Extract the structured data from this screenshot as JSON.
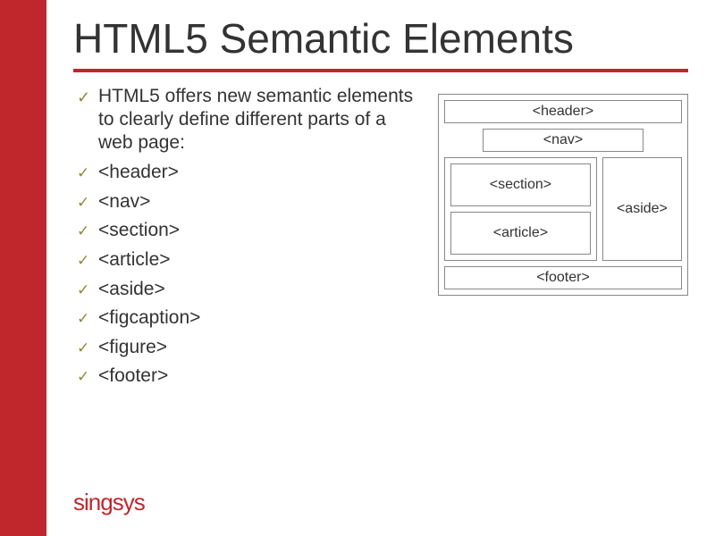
{
  "title": "HTML5 Semantic Elements",
  "intro": "HTML5 offers new semantic elements to clearly define different parts of a web page:",
  "bullets": [
    "<header>",
    "<nav>",
    "<section>",
    "<article>",
    "<aside>",
    "<figcaption>",
    "<figure>",
    "<footer>"
  ],
  "diagram": {
    "header": "<header>",
    "nav": "<nav>",
    "section": "<section>",
    "article": "<article>",
    "aside": "<aside>",
    "footer": "<footer>"
  },
  "brand": "singsys"
}
